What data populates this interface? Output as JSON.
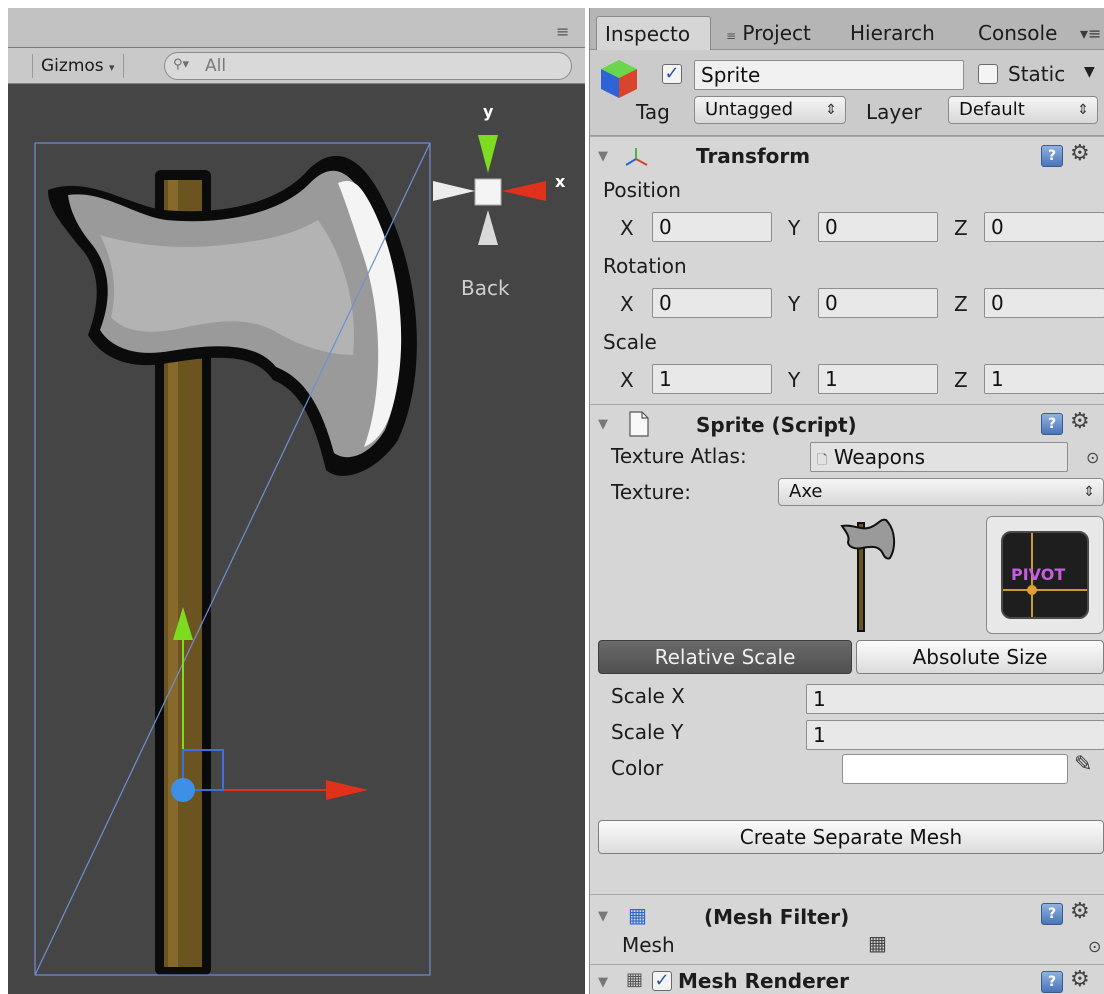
{
  "scene": {
    "menu_icon": "≡",
    "gizmos_label": "Gizmos",
    "search_placeholder": "All",
    "orientation_label": "Back",
    "axis_y": "y",
    "axis_x": "x"
  },
  "inspector": {
    "tabs": [
      "Inspecto",
      "Project",
      "Hierarch",
      "Console"
    ],
    "object_name": "Sprite",
    "object_enabled": true,
    "static_label": "Static",
    "static_checked": false,
    "tag_label": "Tag",
    "tag_value": "Untagged",
    "layer_label": "Layer",
    "layer_value": "Default"
  },
  "transform": {
    "title": "Transform",
    "position_label": "Position",
    "rotation_label": "Rotation",
    "scale_label": "Scale",
    "axis_x": "X",
    "axis_y": "Y",
    "axis_z": "Z",
    "position": [
      "0",
      "0",
      "0"
    ],
    "rotation": [
      "0",
      "0",
      "0"
    ],
    "scale": [
      "1",
      "1",
      "1"
    ]
  },
  "sprite": {
    "title": "Sprite (Script)",
    "atlas_label": "Texture Atlas:",
    "atlas_value": "Weapons",
    "texture_label": "Texture:",
    "texture_value": "Axe",
    "pivot_label": "PIVOT",
    "relative_scale": "Relative Scale",
    "absolute_size": "Absolute Size",
    "scale_x_label": "Scale X",
    "scale_x_value": "1",
    "scale_y_label": "Scale Y",
    "scale_y_value": "1",
    "color_label": "Color",
    "color_value": "#ffffff",
    "create_mesh": "Create Separate Mesh"
  },
  "mesh_filter": {
    "title": "(Mesh Filter)",
    "mesh_label": "Mesh"
  },
  "mesh_renderer": {
    "title": "Mesh Renderer",
    "enabled": true
  },
  "colors": {
    "handle_y": "#7ddc1f",
    "handle_x": "#e0321b",
    "handle_center": "#3d8fe8",
    "bounds": "#6f8fd0",
    "axe_blade": "#9a9a9a",
    "axe_handle": "#6b5420"
  }
}
